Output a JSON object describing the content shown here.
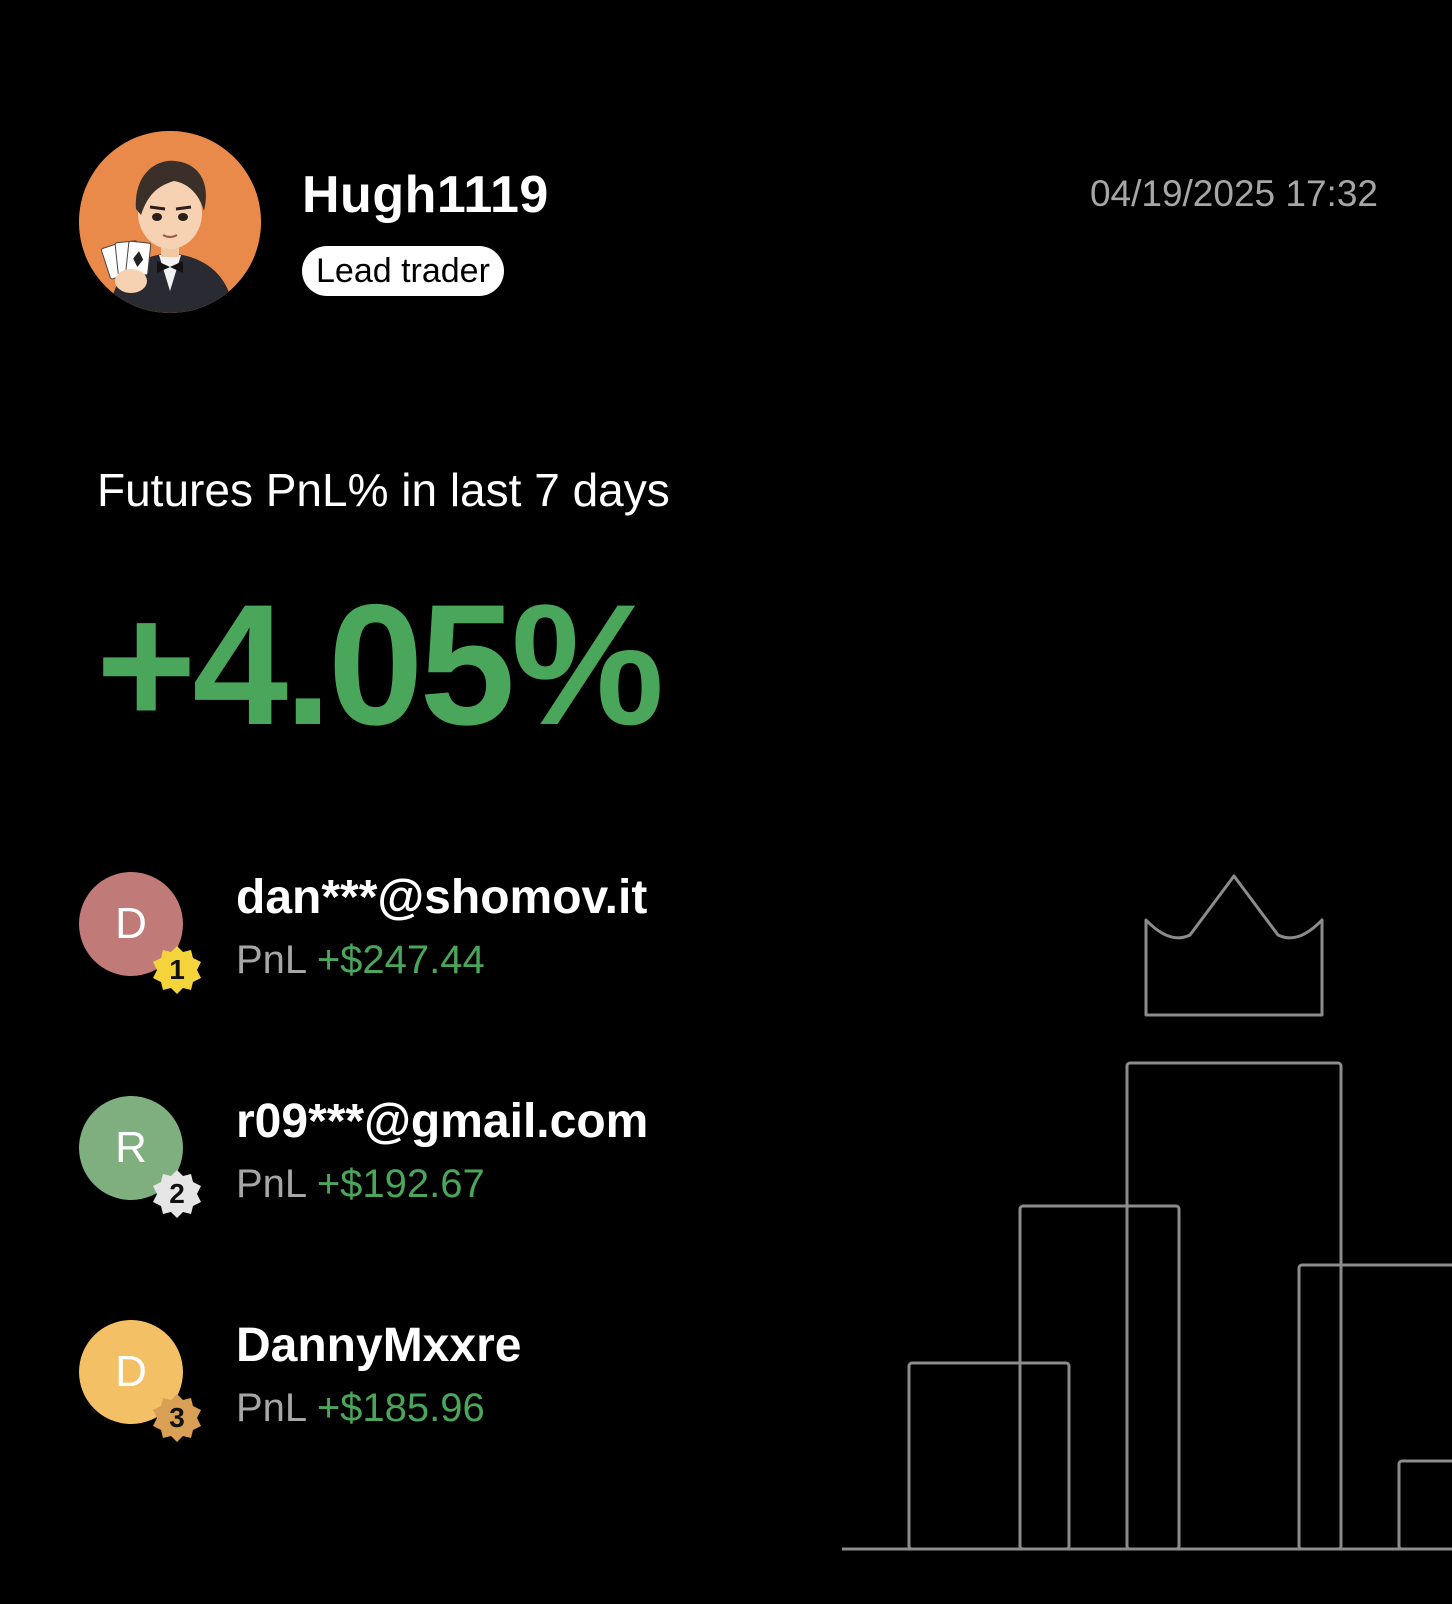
{
  "profile": {
    "username": "Hugh1119",
    "role": "Lead trader",
    "timestamp": "04/19/2025 17:32",
    "avatar_icon": "trader-avatar-illustration"
  },
  "performance": {
    "heading": "Futures PnL% in last 7 days",
    "value": "+4.05%"
  },
  "top_followers": [
    {
      "initial": "D",
      "rank": "1",
      "name": "dan***@shomov.it",
      "pnl_label": "PnL",
      "pnl_value": "+$247.44",
      "avatar_color": "#c07a78",
      "badge_color": "#f5d33a"
    },
    {
      "initial": "R",
      "rank": "2",
      "name": "r09***@gmail.com",
      "pnl_label": "PnL",
      "pnl_value": "+$192.67",
      "avatar_color": "#7fae7f",
      "badge_color": "#e6e6e6"
    },
    {
      "initial": "D",
      "rank": "3",
      "name": "DannyMxxre",
      "pnl_label": "PnL",
      "pnl_value": "+$185.96",
      "avatar_color": "#f4c065",
      "badge_color": "#d99f55"
    }
  ],
  "colors": {
    "background": "#000000",
    "positive": "#4aa65a",
    "muted": "#a6a6a6",
    "outline": "#8c8c8c"
  },
  "decoration_icon": "podium-crown-icon"
}
